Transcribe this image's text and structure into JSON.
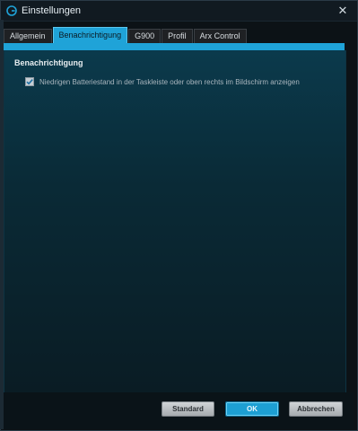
{
  "window": {
    "title": "Einstellungen"
  },
  "tabs": [
    {
      "label": "Allgemein"
    },
    {
      "label": "Benachrichtigung"
    },
    {
      "label": "G900"
    },
    {
      "label": "Profil"
    },
    {
      "label": "Arx Control"
    }
  ],
  "active_tab": "Benachrichtigung",
  "notification": {
    "section_title": "Benachrichtigung",
    "low_battery": {
      "label": "Niedrigen Batteriestand in der Taskleiste oder oben rechts im Bildschirm anzeigen",
      "checked": true
    }
  },
  "footer": {
    "standard_label": "Standard",
    "ok_label": "OK",
    "cancel_label": "Abbrechen"
  },
  "colors": {
    "accent": "#1fa3d8",
    "panel_top": "#0b3a4c",
    "panel_bottom": "#0a1c24"
  },
  "icons": {
    "app": "logitech-g-icon",
    "close": "close-icon",
    "checkbox": "checkmark-icon"
  }
}
